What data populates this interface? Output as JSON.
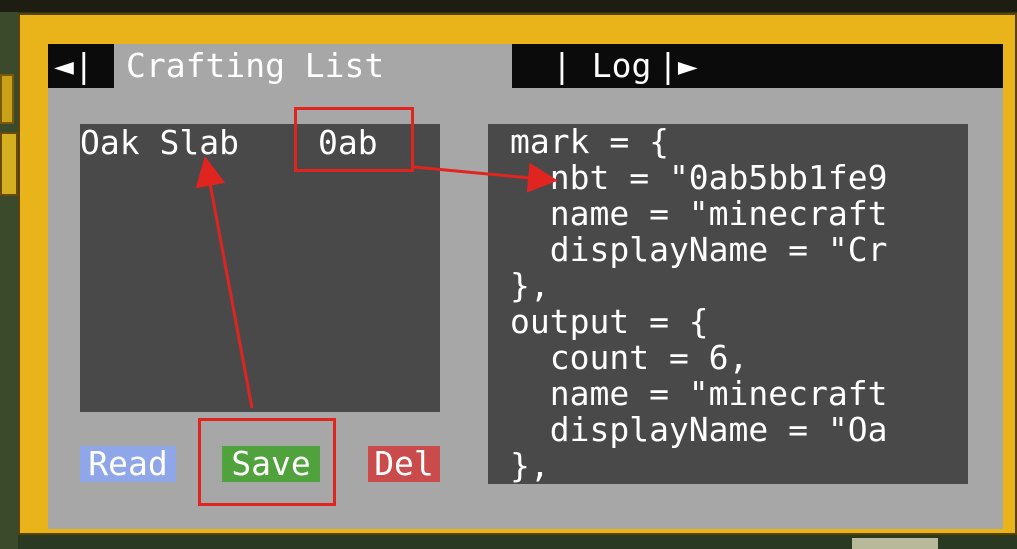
{
  "tabs": {
    "prev": "◄|",
    "crafting_list": "Crafting List",
    "separator": "|",
    "log": "Log",
    "next": "|►"
  },
  "list": {
    "items": [
      {
        "name": "Oak Slab",
        "id": "0ab"
      }
    ]
  },
  "code": {
    "lines": [
      "mark = {",
      "  nbt = \"0ab5bb1fe9",
      "  name = \"minecraft",
      "  displayName = \"Cr",
      "},",
      "output = {",
      "  count = 6,",
      "  name = \"minecraft",
      "  displayName = \"Oa",
      "},"
    ]
  },
  "buttons": {
    "read": "Read",
    "save": "Save",
    "del": "Del"
  },
  "colors": {
    "frame": "#e8b41a",
    "panel": "#a7a7a7",
    "box": "#494949",
    "read": "#8fa6e8",
    "save": "#4fa23c",
    "del": "#c94b4b",
    "annotation": "#e0241f"
  }
}
